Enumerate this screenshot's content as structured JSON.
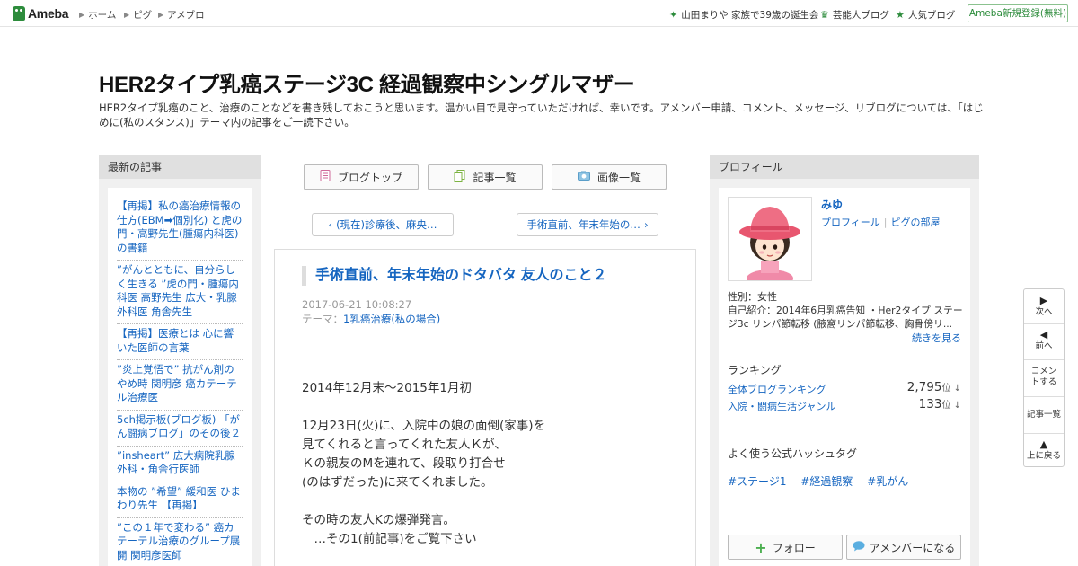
{
  "topbar": {
    "logo": "Ameba",
    "nav": [
      "ホーム",
      "ピグ",
      "アメブロ"
    ],
    "right_links": [
      {
        "icon": "sparkle-icon",
        "label": "山田まりや 家族で39歳の誕生会"
      },
      {
        "icon": "crown-icon",
        "label": "芸能人ブログ"
      },
      {
        "icon": "star-icon",
        "label": "人気ブログ"
      }
    ],
    "signup": "Ameba新規登録(無料)"
  },
  "blog": {
    "title": "HER2タイプ乳癌ステージ3C 経過観察中シングルマザー",
    "description": "HER2タイプ乳癌のこと、治療のことなどを書き残しておこうと思います。温かい目で見守っていただければ、幸いです。アメンバー申請、コメント、メッセージ、リブログについては、「はじめに(私のスタンス)」テーマ内の記事をご一読下さい。"
  },
  "recent": {
    "heading": "最新の記事",
    "items": [
      "【再掲】私の癌治療情報の仕方(EBM➡個別化) と虎の門・高野先生(腫瘍内科医)の書籍",
      "”がんとともに、自分らしく生きる ”虎の門・腫瘍内科医 高野先生 広大・乳腺外科医 角舎先生",
      "【再掲】医療とは 心に響いた医師の言葉",
      "”炎上覚悟で” 抗がん剤のやめ時 関明彦 癌カテーテル治療医",
      "5ch掲示板(ブログ板) 「がん闘病ブログ」のその後２",
      "”insheart” 広大病院乳腺外科・角舎行医師",
      "本物の ”希望” 緩和医 ひまわり先生 【再掲】",
      "”この１年で変わる” 癌カテーテル治療のグループ展開 関明彦医師"
    ]
  },
  "tabs": {
    "top": "ブログトップ",
    "list": "記事一覧",
    "images": "画像一覧"
  },
  "pager": {
    "prev": "(現在)診療後、麻央…",
    "next": "手術直前、年末年始の…"
  },
  "entry": {
    "title": "手術直前、年末年始のドタバタ 友人のこと２",
    "date": "2017-06-21 10:08:27",
    "theme_label": "テーマ：",
    "theme": "1乳癌治療(私の場合)",
    "body": [
      "2014年12月末～2015年1月初",
      "",
      "12月23日(火)に、入院中の娘の面倒(家事)を",
      "見てくれると言ってくれた友人Ｋが、",
      "Ｋの親友のMを連れて、段取り打合せ",
      "(のはずだった)に来てくれました。",
      "",
      "その時の友人Kの爆弾発言。",
      "　…その1(前記事)をご覧下さい"
    ]
  },
  "profile": {
    "heading": "プロフィール",
    "nickname": "みゆ",
    "link_profile": "プロフィール",
    "link_pig": "ピグの部屋",
    "gender": "性別：女性",
    "intro": "自己紹介：2014年6月乳癌告知 ・Her2タイプ ステージ3c リンパ節転移 (腋窩リンパ節転移、胸骨傍リ...",
    "more": "続きを見る",
    "ranking_heading": "ランキング",
    "rankings": [
      {
        "name": "全体ブログランキング",
        "value": "2,795",
        "unit": "位 ↓"
      },
      {
        "name": "入院・闘病生活ジャンル",
        "value": "133",
        "unit": "位 ↓"
      }
    ],
    "hashtag_heading": "よく使う公式ハッシュタグ",
    "hashtags": [
      "#ステージ1",
      "#経過観察",
      "#乳がん"
    ],
    "follow": "フォロー",
    "amember": "アメンバーになる"
  },
  "floatnav": {
    "next": "次へ",
    "prev": "前へ",
    "comment": "コメントする",
    "list": "記事一覧",
    "top": "上に戻る"
  },
  "colors": {
    "brand": "#2d8c3c",
    "link": "#1565c0"
  }
}
